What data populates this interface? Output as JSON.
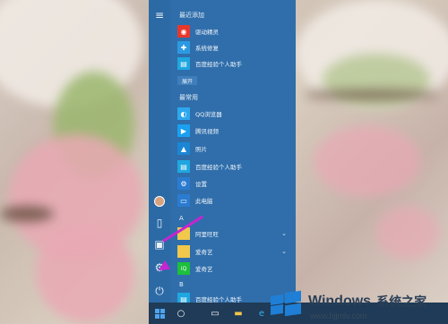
{
  "menu": {
    "section_recent": "最近添加",
    "recent": [
      {
        "label": "驱动精灵",
        "icon": "driver-genius-icon",
        "color": "#e8382c"
      },
      {
        "label": "系统修复",
        "icon": "system-repair-icon",
        "color": "#2b9ae2"
      },
      {
        "label": "百度经验个人助手",
        "icon": "baidu-assistant-icon",
        "color": "#1fa7e0"
      }
    ],
    "expand_label": "展开",
    "section_frequent": "最常用",
    "frequent": [
      {
        "label": "QQ浏览器",
        "icon": "qq-browser-icon",
        "color": "#2da7ee"
      },
      {
        "label": "腾讯视频",
        "icon": "tencent-video-icon",
        "color": "#19a0f0"
      },
      {
        "label": "照片",
        "icon": "photos-icon",
        "color": "#1c86d6"
      },
      {
        "label": "百度经验个人助手",
        "icon": "baidu-assistant-icon",
        "color": "#1fa7e0"
      },
      {
        "label": "设置",
        "icon": "settings-icon",
        "color": "#2b7bd0"
      },
      {
        "label": "此电脑",
        "icon": "this-pc-icon",
        "color": "#2b7bd0"
      }
    ],
    "letter_a": "A",
    "alpha_a": [
      {
        "label": "阿里旺旺",
        "icon": "folder-icon",
        "color": "#f1c84b",
        "has_chevron": true
      },
      {
        "label": "爱奇艺",
        "icon": "folder-icon",
        "color": "#f1c84b",
        "has_chevron": true
      },
      {
        "label": "爱奇艺",
        "icon": "iqiyi-icon",
        "color": "#1dbf3c",
        "has_chevron": false
      }
    ],
    "letter_b": "B",
    "alpha_b": [
      {
        "label": "百度经验个人助手",
        "icon": "baidu-assistant-icon",
        "color": "#1fa7e0"
      }
    ]
  },
  "rail": {
    "items": [
      "hamburger-icon",
      "avatar",
      "document-icon",
      "pictures-icon",
      "settings-icon",
      "power-icon"
    ]
  },
  "taskbar": {
    "items": [
      "start-icon",
      "cortana-icon",
      "task-view-icon",
      "file-explorer-icon",
      "edge-icon"
    ]
  },
  "watermark": {
    "brand": "Windows",
    "cn": "系统之家",
    "url": "www.bjjmlv.com"
  }
}
